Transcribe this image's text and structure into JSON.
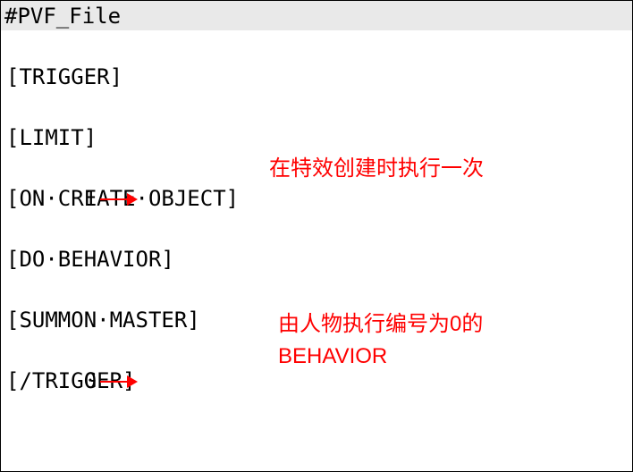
{
  "title": "#PVF_File",
  "code": {
    "l1": "[TRIGGER]",
    "l2": "[LIMIT]",
    "num1": "1",
    "l3": "[ON·CREATE·OBJECT]",
    "l4": "[DO·BEHAVIOR]",
    "l5": "[SUMMON·MASTER]",
    "num2": "0",
    "l6": "[/TRIGGER]"
  },
  "annotations": {
    "a1": "在特效创建时执行一次",
    "a2": "由人物执行编号为0的BEHAVIOR"
  }
}
